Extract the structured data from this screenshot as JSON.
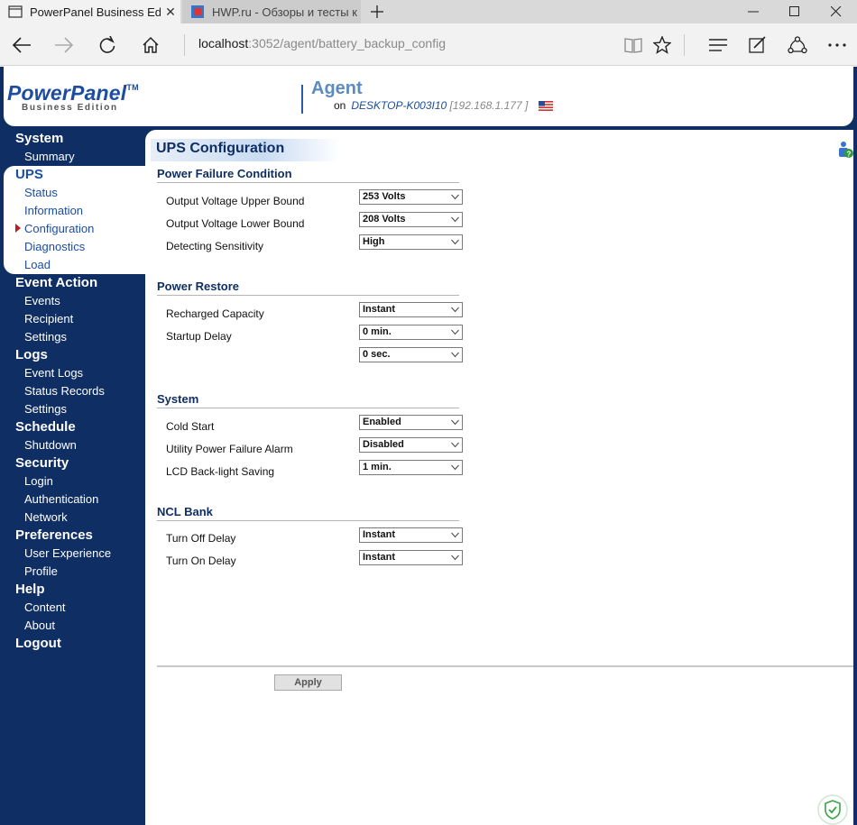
{
  "browser": {
    "tabs": [
      {
        "title": "PowerPanel Business Ed",
        "active": true
      },
      {
        "title": "HWP.ru - Обзоры и тесты к",
        "active": false
      }
    ],
    "address": {
      "host": "localhost",
      "rest": ":3052/agent/battery_backup_config"
    }
  },
  "header": {
    "logo_main": "PowerPanel",
    "logo_tm": "TM",
    "logo_sub": "Business Edition",
    "agent_title": "Agent",
    "on_label": "on",
    "host_name": "DESKTOP-K003I10",
    "host_ip": "[192.168.1.177 ]"
  },
  "sidebar": {
    "system": "System",
    "summary": "Summary",
    "ups": "UPS",
    "status": "Status",
    "information": "Information",
    "configuration": "Configuration",
    "diagnostics": "Diagnostics",
    "load": "Load",
    "event_action": "Event Action",
    "events": "Events",
    "recipient": "Recipient",
    "ea_settings": "Settings",
    "logs": "Logs",
    "event_logs": "Event Logs",
    "status_records": "Status Records",
    "log_settings": "Settings",
    "schedule": "Schedule",
    "shutdown": "Shutdown",
    "security": "Security",
    "login": "Login",
    "authentication": "Authentication",
    "network": "Network",
    "preferences": "Preferences",
    "user_experience": "User Experience",
    "profile": "Profile",
    "help": "Help",
    "content": "Content",
    "about": "About",
    "logout": "Logout"
  },
  "main": {
    "page_title": "UPS Configuration",
    "power_failure": {
      "title": "Power Failure Condition",
      "upper_label": "Output Voltage Upper Bound",
      "upper_value": "253 Volts",
      "lower_label": "Output Voltage Lower Bound",
      "lower_value": "208 Volts",
      "sens_label": "Detecting Sensitivity",
      "sens_value": "High"
    },
    "power_restore": {
      "title": "Power Restore",
      "capacity_label": "Recharged Capacity",
      "capacity_value": "Instant",
      "startup_label": "Startup Delay",
      "startup_min": "0 min.",
      "startup_sec": "0 sec."
    },
    "system": {
      "title": "System",
      "cold_label": "Cold Start",
      "cold_value": "Enabled",
      "alarm_label": "Utility Power Failure Alarm",
      "alarm_value": "Disabled",
      "lcd_label": "LCD Back-light Saving",
      "lcd_value": "1 min."
    },
    "ncl": {
      "title": "NCL Bank",
      "off_label": "Turn Off Delay",
      "off_value": "Instant",
      "on_label": "Turn On Delay",
      "on_value": "Instant"
    },
    "apply_label": "Apply"
  },
  "colors": {
    "navy": "#0f2e63",
    "link_blue": "#1c4da0",
    "agent_blue": "#5b8cc0",
    "active_arrow": "#b22222"
  }
}
